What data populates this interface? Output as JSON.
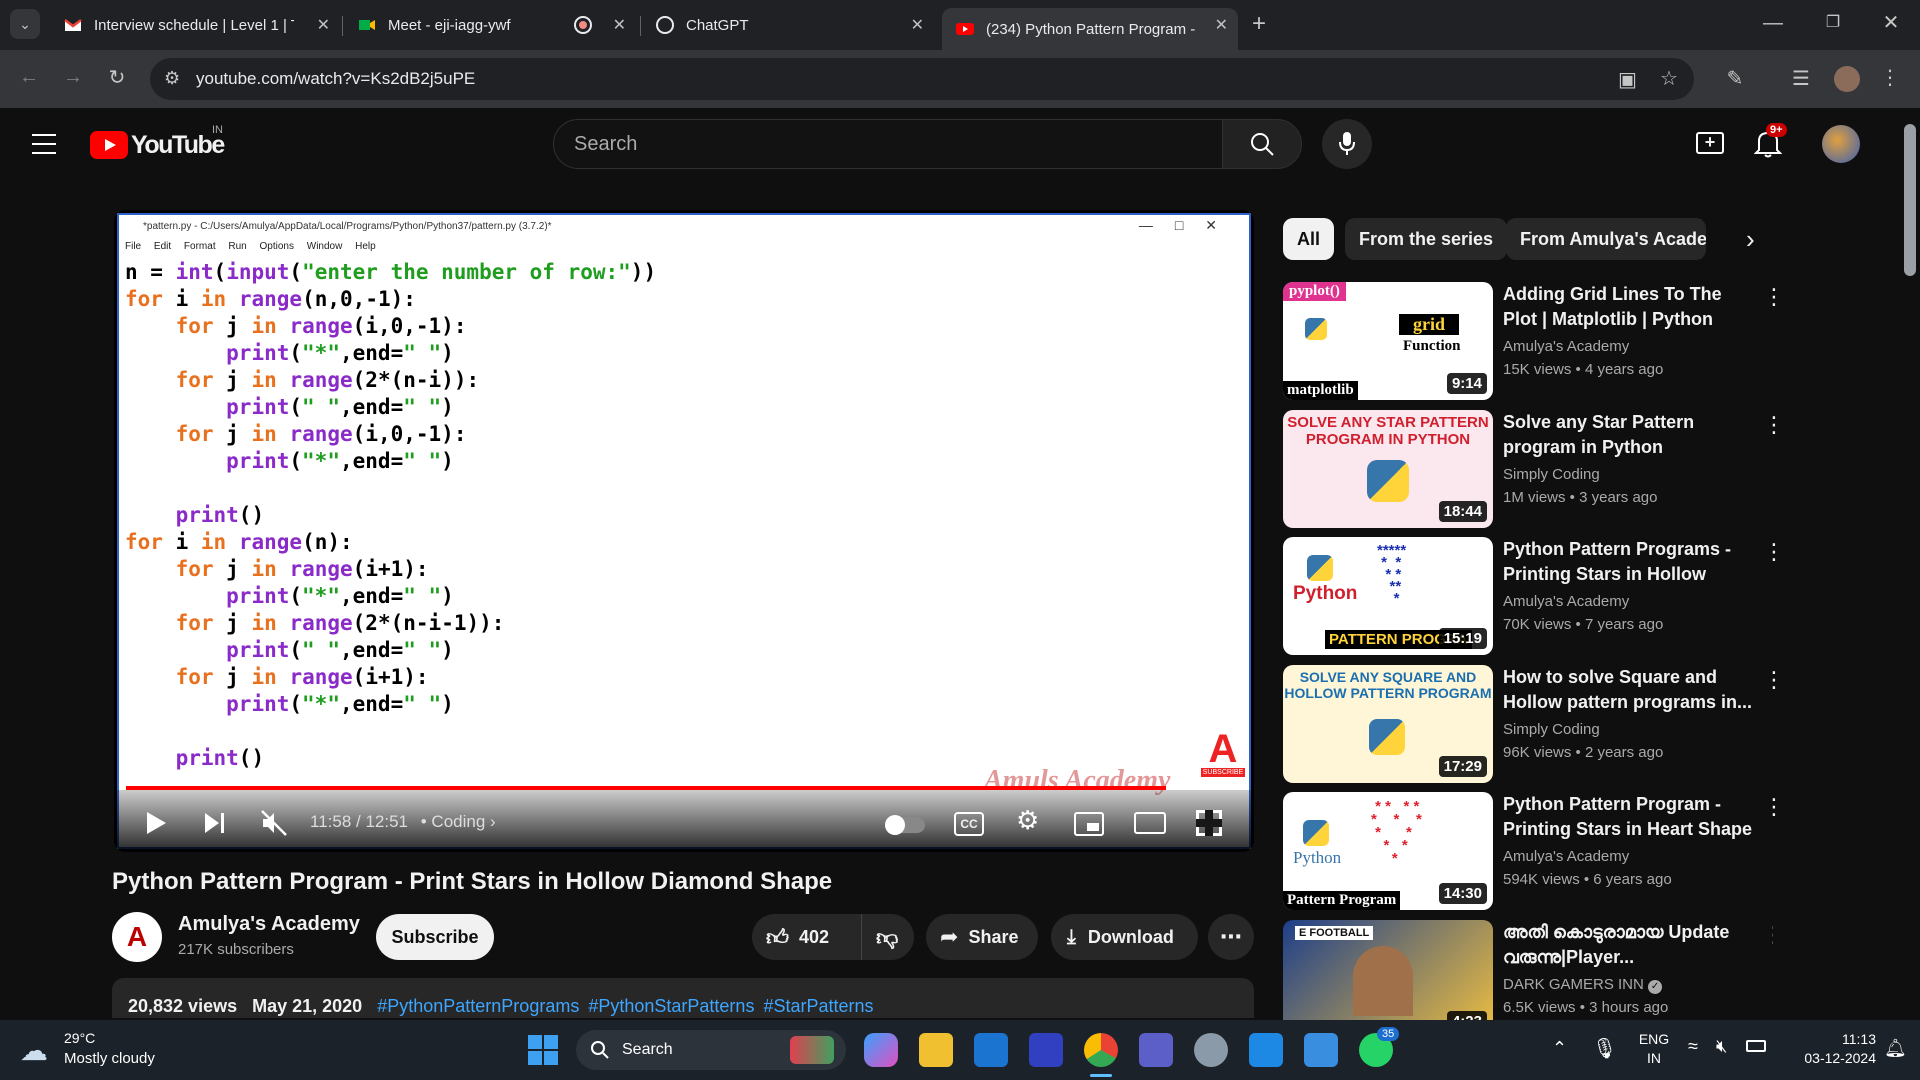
{
  "browser": {
    "tabs": [
      {
        "title": "Interview schedule | Level 1 | Tra",
        "icon": "gmail-icon"
      },
      {
        "title": "Meet - eji-iagg-ywf",
        "icon": "meet-icon"
      },
      {
        "title": "ChatGPT",
        "icon": "chatgpt-icon"
      },
      {
        "title": "(234) Python Pattern Program -",
        "icon": "youtube-icon",
        "active": true
      }
    ],
    "url": "youtube.com/watch?v=Ks2dB2j5uPE"
  },
  "youtube": {
    "logo_text": "YouTube",
    "country": "IN",
    "search_placeholder": "Search",
    "notifications": "9+"
  },
  "video": {
    "idle_title": "*pattern.py - C:/Users/Amulya/AppData/Local/Programs/Python/Python37/pattern.py (3.7.2)*",
    "idle_menu": [
      "File",
      "Edit",
      "Format",
      "Run",
      "Options",
      "Window",
      "Help"
    ],
    "code_lines": [
      "n = int(input(\"enter the number of row:\"))",
      "for i in range(n,0,-1):",
      "    for j in range(i,0,-1):",
      "        print(\"*\",end=\" \")",
      "    for j in range(2*(n-i)):",
      "        print(\" \",end=\" \")",
      "    for j in range(i,0,-1):",
      "        print(\"*\",end=\" \")",
      "",
      "    print()",
      "for i in range(n):",
      "    for j in range(i+1):",
      "        print(\"*\",end=\" \")",
      "    for j in range(2*(n-i-1)):",
      "        print(\" \",end=\" \")",
      "    for j in range(i+1):",
      "        print(\"*\",end=\" \")",
      "",
      "    print()"
    ],
    "watermark": "Amuls Academy",
    "progress_fraction": 0.932,
    "time": "11:58 / 12:51",
    "chapter": "Coding",
    "title": "Python Pattern Program - Print Stars in Hollow Diamond Shape",
    "channel": "Amulya's Academy",
    "subscribers": "217K subscribers",
    "subscribe_label": "Subscribe",
    "likes": "402",
    "share_label": "Share",
    "download_label": "Download",
    "views": "20,832 views",
    "date": "May 21, 2020",
    "hashtags": [
      "#PythonPatternPrograms",
      "#PythonStarPatterns",
      "#StarPatterns"
    ]
  },
  "chips": [
    "All",
    "From the series",
    "From Amulya's Academy"
  ],
  "recommendations": [
    {
      "title": "Adding Grid Lines To The Plot | Matplotlib | Python Tutorials",
      "channel": "Amulya's Academy",
      "meta": "15K views • 4 years ago",
      "duration": "9:14",
      "thumb_top": "pyplot()",
      "thumb_mid": "grid",
      "thumb_mid2": "Function",
      "thumb_bottom": "matplotlib"
    },
    {
      "title": "Solve any Star Pattern program in Python",
      "channel": "Simply Coding",
      "meta": "1M views • 3 years ago",
      "duration": "18:44",
      "thumb_top": "SOLVE ANY STAR PATTERN PROGRAM IN PYTHON"
    },
    {
      "title": "Python Pattern Programs - Printing Stars in Hollow Right...",
      "channel": "Amulya's Academy",
      "meta": "70K views • 7 years ago",
      "duration": "15:19",
      "thumb_mid": "Python",
      "thumb_bottom": "PATTERN PROGRA"
    },
    {
      "title": "How to solve Square and Hollow pattern programs in...",
      "channel": "Simply Coding",
      "meta": "96K views • 2 years ago",
      "duration": "17:29",
      "thumb_top": "SOLVE ANY SQUARE AND HOLLOW PATTERN PROGRAM"
    },
    {
      "title": "Python Pattern Program - Printing Stars in Heart Shape",
      "channel": "Amulya's Academy",
      "meta": "594K views • 6 years ago",
      "duration": "14:30",
      "thumb_mid": "Python",
      "thumb_bottom": "Pattern Program"
    },
    {
      "title": "അതി കൊടുരാമായ Update വരുന്നു|Player...",
      "channel": "DARK GAMERS INN",
      "meta": "6.5K views • 3 hours ago",
      "duration": "4:23",
      "thumb_top": "E FOOTBALL"
    }
  ],
  "taskbar": {
    "weather_temp": "29°C",
    "weather_desc": "Mostly cloudy",
    "search_label": "Search",
    "lang1": "ENG",
    "lang2": "IN",
    "time": "11:13",
    "date": "03-12-2024",
    "whatsapp_badge": "35"
  },
  "colors": {
    "accent": "#ff0000",
    "link": "#3ea6ff",
    "background": "#0f0f0f"
  }
}
